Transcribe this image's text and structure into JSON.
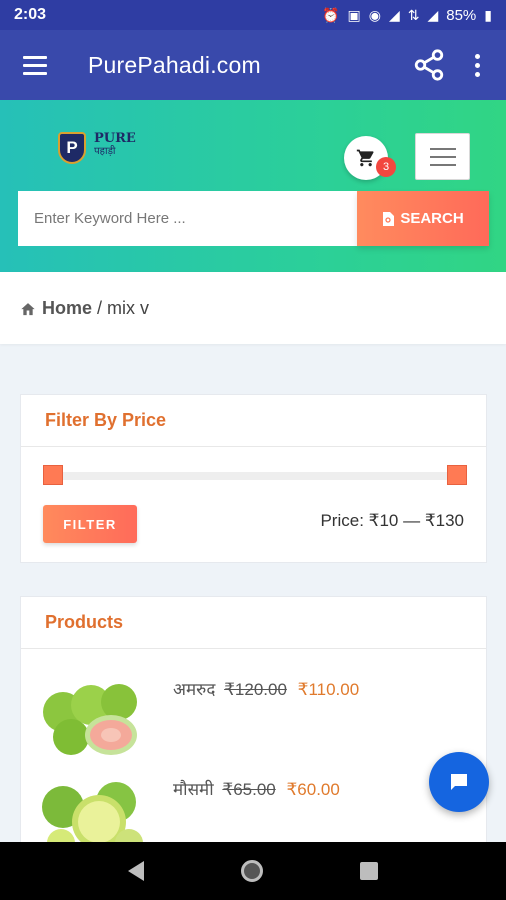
{
  "status_bar": {
    "time": "2:03",
    "battery": "85%"
  },
  "app_bar": {
    "title": "PurePahadi.com"
  },
  "logo": {
    "line1": "PURE",
    "line2": "पहाड़ी",
    "mark": "P"
  },
  "cart": {
    "count": "3"
  },
  "search": {
    "placeholder": "Enter Keyword Here ...",
    "button_label": "SEARCH"
  },
  "breadcrumb": {
    "home": "Home",
    "separator": "/",
    "current": "mix v"
  },
  "filter": {
    "title": "Filter By Price",
    "button_label": "FILTER",
    "price_label": "Price: ₹10 — ₹130",
    "min_fraction": 0,
    "max_fraction": 1
  },
  "products": {
    "title": "Products",
    "items": [
      {
        "name": "अमरुद",
        "old_price": "₹120.00",
        "new_price": "₹110.00",
        "icon": "guava-image"
      },
      {
        "name": "मौसमी",
        "old_price": "₹65.00",
        "new_price": "₹60.00",
        "icon": "sweet-lime-image"
      }
    ]
  },
  "colors": {
    "app_bar": "#3949ab",
    "status_bar": "#2f3da3",
    "accent_orange": "#ff7a54",
    "hero_green": "#2bcf9a",
    "fab_blue": "#1565e0"
  }
}
